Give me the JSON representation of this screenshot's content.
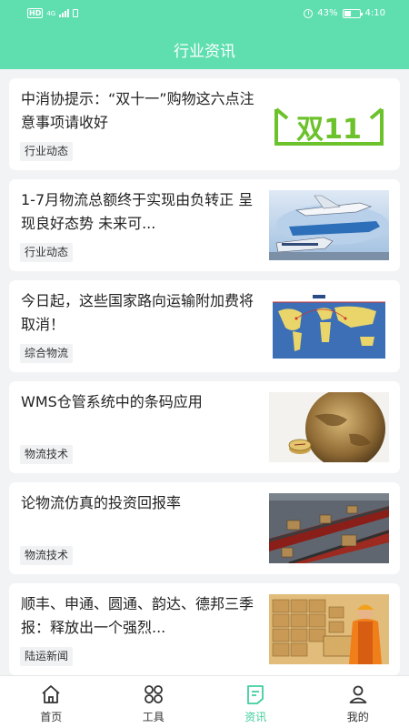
{
  "status_bar": {
    "carrier": "HD",
    "network": "4G",
    "battery": "43%",
    "time": "4:10"
  },
  "header": {
    "title": "行业资讯"
  },
  "articles": [
    {
      "title": "中消协提示：“双十一”购物这六点注意事项请收好",
      "tag": "行业动态",
      "thumb_text": "双11"
    },
    {
      "title": "1-7月物流总额终于实现由负转正 呈现良好态势 未来可...",
      "tag": "行业动态"
    },
    {
      "title": "今日起，这些国家路向运输附加费将取消！",
      "tag": "综合物流"
    },
    {
      "title": "WMS仓管系统中的条码应用",
      "tag": "物流技术"
    },
    {
      "title": "论物流仿真的投资回报率",
      "tag": "物流技术"
    },
    {
      "title": "顺丰、申通、圆通、韵达、德邦三季报：释放出一个强烈...",
      "tag": "陆运新闻"
    }
  ],
  "nav": {
    "items": [
      {
        "label": "首页",
        "icon": "home-icon"
      },
      {
        "label": "工具",
        "icon": "grid-icon"
      },
      {
        "label": "资讯",
        "icon": "news-icon",
        "active": true
      },
      {
        "label": "我的",
        "icon": "user-icon"
      }
    ]
  },
  "colors": {
    "accent": "#5fdfb0",
    "active_nav": "#3fcf9c"
  }
}
